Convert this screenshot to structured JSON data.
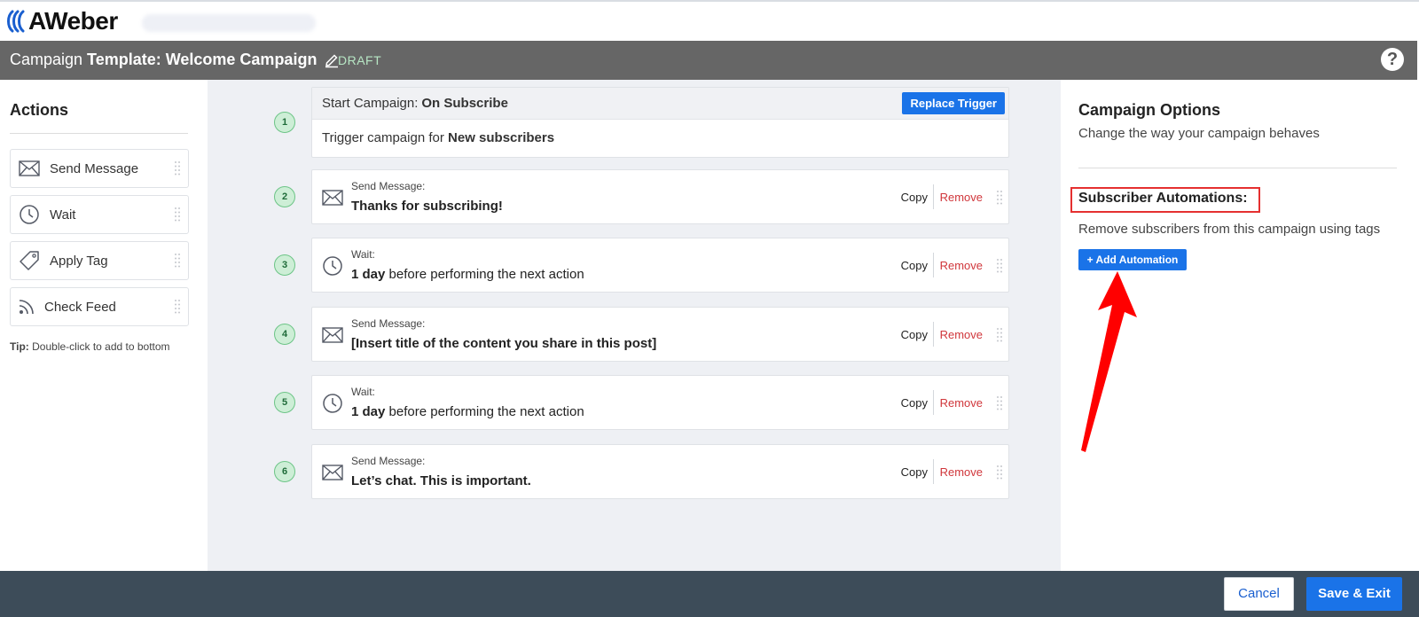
{
  "app": {
    "logo_text": "AWeber"
  },
  "titlebar": {
    "prefix": "Campaign",
    "name": "Template: Welcome Campaign",
    "status": "DRAFT",
    "help_symbol": "?"
  },
  "actions": {
    "heading": "Actions",
    "items": [
      {
        "label": "Send Message",
        "icon": "envelope-icon"
      },
      {
        "label": "Wait",
        "icon": "clock-icon"
      },
      {
        "label": "Apply Tag",
        "icon": "tag-icon"
      },
      {
        "label": "Check Feed",
        "icon": "rss-icon"
      }
    ],
    "tip_label": "Tip:",
    "tip_text": "Double-click to add to bottom"
  },
  "trigger": {
    "step": "1",
    "head_label": "Start Campaign:",
    "head_value": "On Subscribe",
    "replace_label": "Replace Trigger",
    "body_label": "Trigger campaign for",
    "body_value": "New subscribers"
  },
  "steps": [
    {
      "num": "2",
      "kind": "Send Message:",
      "desc_bold": "Thanks for subscribing!",
      "desc_rest": "",
      "icon": "envelope-icon"
    },
    {
      "num": "3",
      "kind": "Wait:",
      "desc_bold": "1 day",
      "desc_rest": " before performing the next action",
      "icon": "clock-icon"
    },
    {
      "num": "4",
      "kind": "Send Message:",
      "desc_bold": "[Insert title of the content you share in this post]",
      "desc_rest": "",
      "icon": "envelope-icon"
    },
    {
      "num": "5",
      "kind": "Wait:",
      "desc_bold": "1 day",
      "desc_rest": " before performing the next action",
      "icon": "clock-icon"
    },
    {
      "num": "6",
      "kind": "Send Message:",
      "desc_bold": "Let’s chat. This is important.",
      "desc_rest": "",
      "icon": "envelope-icon"
    }
  ],
  "step_actions": {
    "copy_label": "Copy",
    "remove_label": "Remove"
  },
  "options": {
    "heading": "Campaign Options",
    "subheading": "Change the way your campaign behaves",
    "automations_title": "Subscriber Automations:",
    "automations_desc": "Remove subscribers from this campaign using tags",
    "add_label": "+ Add Automation"
  },
  "footer": {
    "cancel_label": "Cancel",
    "save_label": "Save & Exit"
  },
  "colors": {
    "primary": "#1a73e8",
    "danger": "#d0363b",
    "draft": "#b7e6c4",
    "annotation": "#ff0000"
  }
}
